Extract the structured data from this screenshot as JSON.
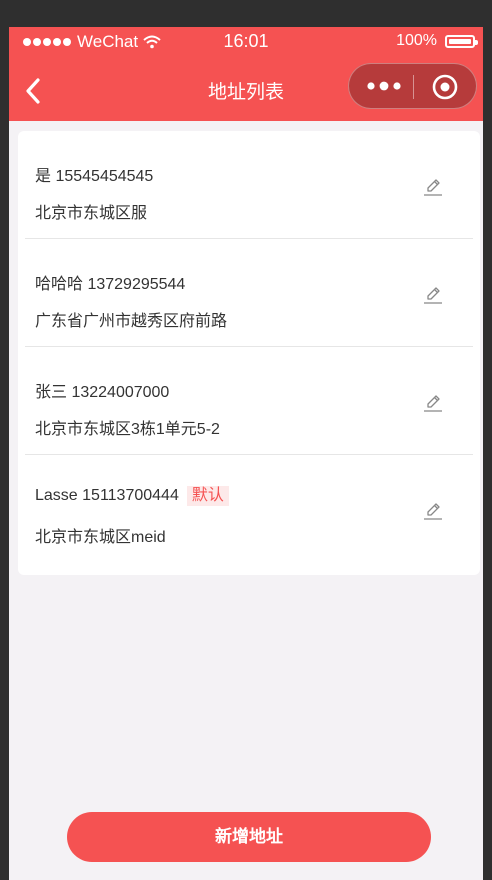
{
  "status_bar": {
    "carrier": "WeChat",
    "time": "16:01",
    "battery_percent": "100%",
    "signal_icon": "signal-dots-icon",
    "wifi_icon": "wifi-icon"
  },
  "nav": {
    "title": "地址列表",
    "back_icon": "chevron-left-icon",
    "more_icon": "more-dots-icon",
    "close_icon": "target-circle-icon"
  },
  "addresses": [
    {
      "name_phone": "是 15545454545",
      "address": "北京市东城区服",
      "default_label": ""
    },
    {
      "name_phone": "哈哈哈 13729295544",
      "address": "广东省广州市越秀区府前路",
      "default_label": ""
    },
    {
      "name_phone": "张三 13224007000",
      "address": "北京市东城区3栋1单元5-2",
      "default_label": ""
    },
    {
      "name_phone": "Lasse 15113700444",
      "address": "北京市东城区meid",
      "default_label": "默认"
    }
  ],
  "footer": {
    "add_button_label": "新增地址"
  },
  "colors": {
    "accent": "#f55252",
    "background": "#f4f2f5",
    "badge_bg": "#fde9e9"
  }
}
